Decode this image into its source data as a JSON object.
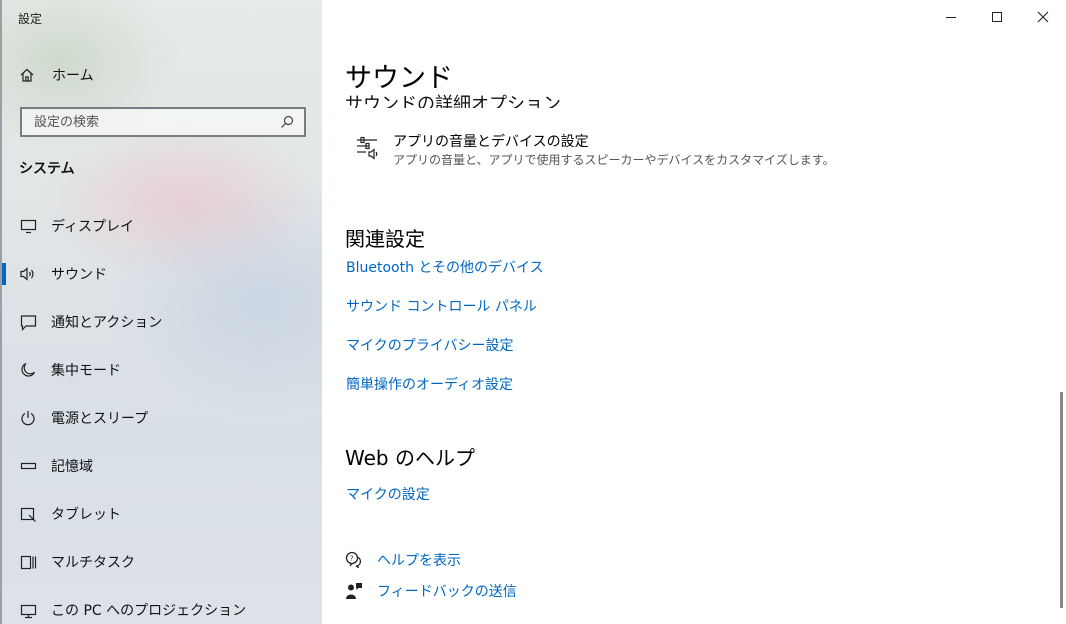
{
  "window": {
    "title": "設定"
  },
  "sidebar": {
    "home_label": "ホーム",
    "search_placeholder": "設定の検索",
    "section_title": "システム",
    "items": [
      {
        "label": "ディスプレイ",
        "icon": "monitor-icon"
      },
      {
        "label": "サウンド",
        "icon": "speaker-icon",
        "active": true
      },
      {
        "label": "通知とアクション",
        "icon": "notification-icon"
      },
      {
        "label": "集中モード",
        "icon": "moon-icon"
      },
      {
        "label": "電源とスリープ",
        "icon": "power-icon"
      },
      {
        "label": "記憶域",
        "icon": "storage-icon"
      },
      {
        "label": "タブレット",
        "icon": "tablet-icon"
      },
      {
        "label": "マルチタスク",
        "icon": "multitask-icon"
      },
      {
        "label": "この PC へのプロジェクション",
        "icon": "projection-icon"
      }
    ]
  },
  "main": {
    "page_title": "サウンド",
    "partial_heading": "サウンドの詳細オプション",
    "app_volume": {
      "title": "アプリの音量とデバイスの設定",
      "description": "アプリの音量と、アプリで使用するスピーカーやデバイスをカスタマイズします。"
    },
    "related": {
      "heading": "関連設定",
      "links": [
        "Bluetooth とその他のデバイス",
        "サウンド コントロール パネル",
        "マイクのプライバシー設定",
        "簡単操作のオーディオ設定"
      ]
    },
    "web_help": {
      "heading": "Web のヘルプ",
      "link": "マイクの設定"
    },
    "help_actions": {
      "get_help": "ヘルプを表示",
      "feedback": "フィードバックの送信"
    }
  },
  "colors": {
    "accent": "#0067c0",
    "sidebar_bg": "#dfe4e6"
  }
}
